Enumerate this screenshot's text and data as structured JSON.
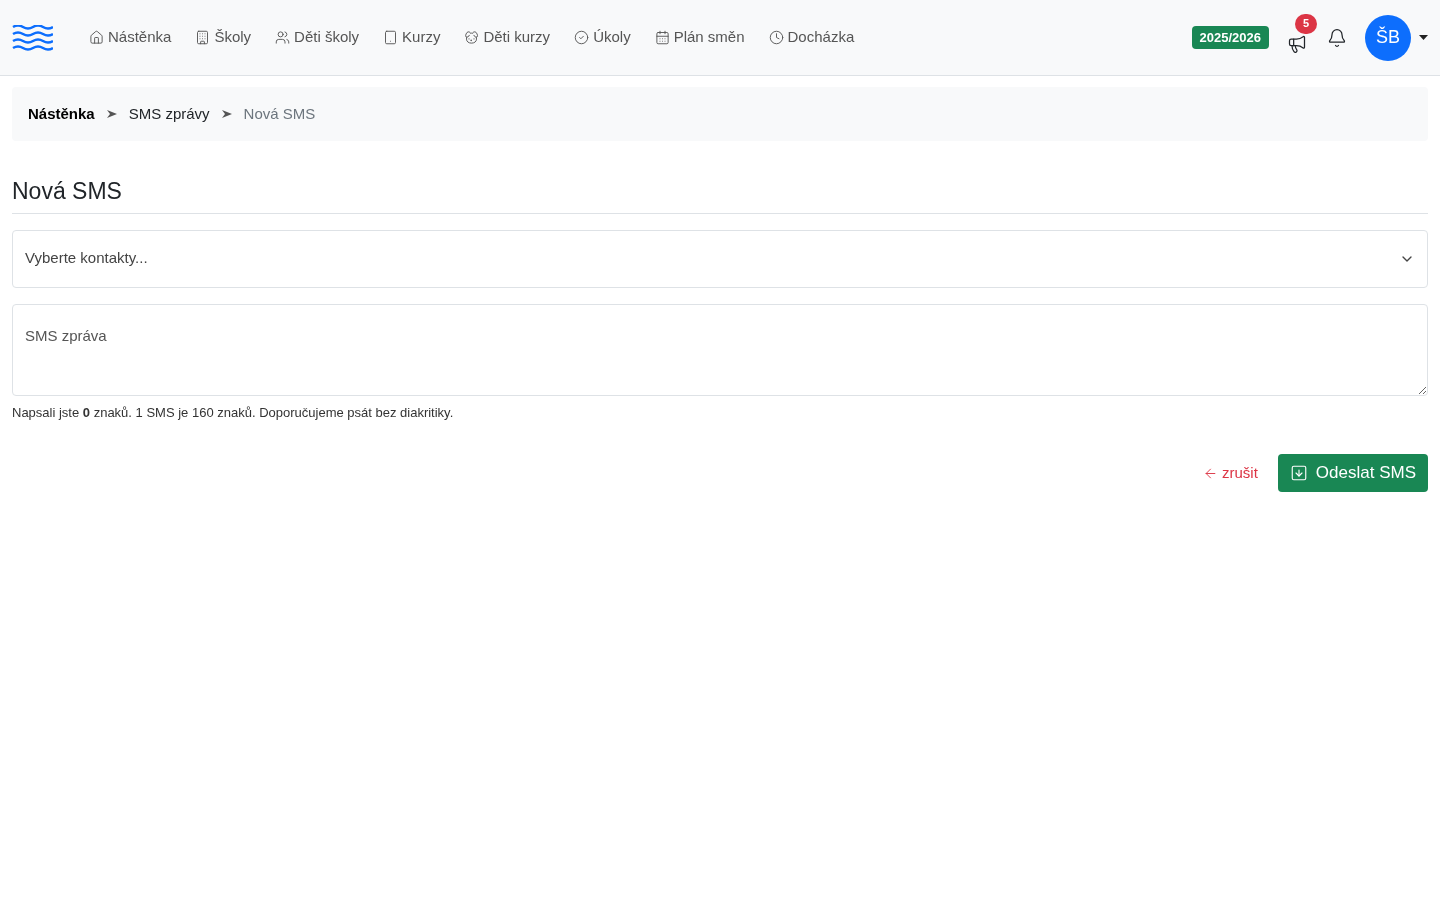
{
  "nav": {
    "items": [
      {
        "label": "Nástěnka",
        "selected": false
      },
      {
        "label": "Školy",
        "selected": false
      },
      {
        "label": "Děti školy",
        "selected": false
      },
      {
        "label": "Kurzy",
        "selected": false
      },
      {
        "label": "Děti kurzy",
        "selected": false
      },
      {
        "label": "Úkoly",
        "selected": false
      },
      {
        "label": "Plán směn",
        "selected": false
      },
      {
        "label": "Docházka",
        "selected": false
      }
    ],
    "year_badge": "2025/2026",
    "announcements_count": "5",
    "avatar": "ŠB"
  },
  "breadcrumb": [
    "Nástěnka",
    "SMS zprávy",
    "Nová SMS"
  ],
  "page_title": "Nová SMS",
  "contacts_select": {
    "placeholder": "Vyberte kontakty..."
  },
  "message": {
    "placeholder": "SMS zpráva"
  },
  "counter": "Napsali jste **0** znaků. 1 SMS je 160 znaků. Doporučujeme psát bez diakritiky.",
  "cancel": "zrušit",
  "submit": "Odeslat SMS"
}
